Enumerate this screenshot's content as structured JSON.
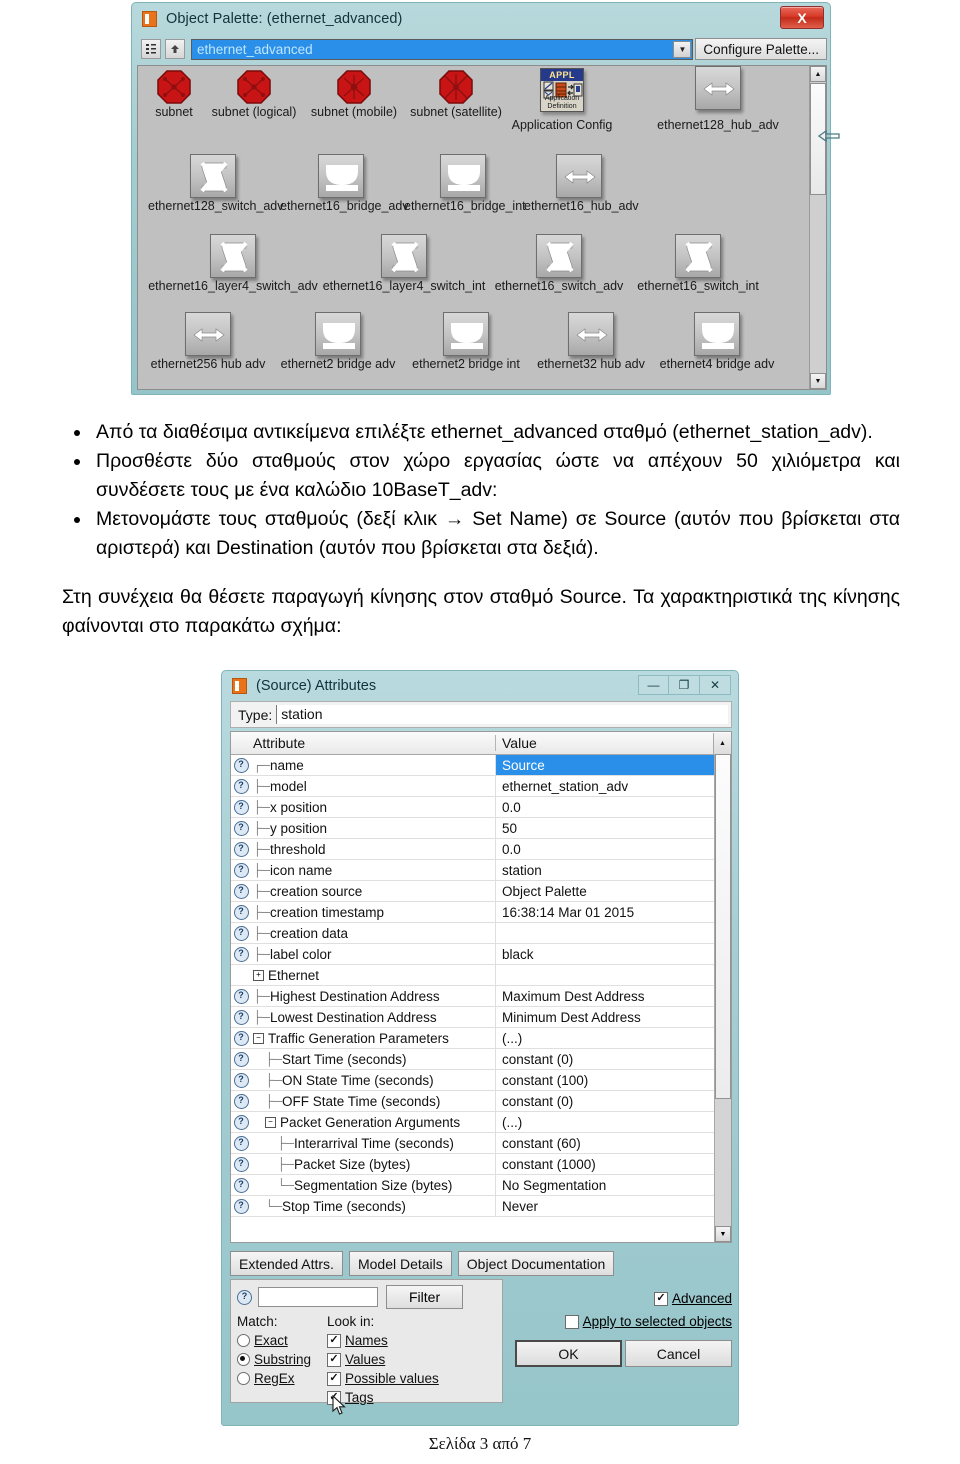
{
  "palette_window": {
    "title": "Object Palette: (ethernet_advanced)",
    "close_label": "X",
    "toolbar": {
      "tree_button_icon": "tree-view-icon",
      "up_button_icon": "up-level-icon",
      "combo_value": "ethernet_advanced",
      "combo_arrow": "▼",
      "configure_button": "Configure Palette..."
    },
    "scrollbar": {
      "up": "▲",
      "down": "▼"
    },
    "rows": [
      {
        "items": [
          {
            "label": "subnet",
            "icon": "subnet-octagon-icon"
          },
          {
            "label": "subnet (logical)",
            "icon": "subnet-logical-octagon-icon"
          },
          {
            "label": "subnet (mobile)",
            "icon": "subnet-mobile-octagon-icon"
          },
          {
            "label": "subnet (satellite)",
            "icon": "subnet-satellite-octagon-icon"
          },
          {
            "label": "Application Config",
            "icon": "application-definition-icon",
            "badge": "APPL",
            "caption": "Application\nDefinition"
          },
          {
            "label": "ethernet128_hub_adv",
            "icon": "hub-device-icon"
          }
        ]
      },
      {
        "items": [
          {
            "label": "ethernet128_switch_adv",
            "icon": "switch-device-icon"
          },
          {
            "label": "ethernet16_bridge_adv",
            "icon": "bridge-device-icon"
          },
          {
            "label": "ethernet16_bridge_int",
            "icon": "bridge-device-icon"
          },
          {
            "label": "ethernet16_hub_adv",
            "icon": "hub-device-icon"
          }
        ]
      },
      {
        "items": [
          {
            "label": "ethernet16_layer4_switch_adv",
            "icon": "switch-device-icon"
          },
          {
            "label": "ethernet16_layer4_switch_int",
            "icon": "switch-device-icon"
          },
          {
            "label": "ethernet16_switch_adv",
            "icon": "switch-device-icon"
          },
          {
            "label": "ethernet16_switch_int",
            "icon": "switch-device-icon"
          }
        ]
      },
      {
        "items": [
          {
            "label": "ethernet256 hub adv",
            "icon": "hub-device-icon"
          },
          {
            "label": "ethernet2 bridge adv",
            "icon": "bridge-device-icon"
          },
          {
            "label": "ethernet2 bridge int",
            "icon": "bridge-device-icon"
          },
          {
            "label": "ethernet32 hub adv",
            "icon": "hub-device-icon"
          },
          {
            "label": "ethernet4 bridge adv",
            "icon": "bridge-device-icon"
          }
        ]
      }
    ]
  },
  "document": {
    "bullets": [
      "Από τα διαθέσιμα αντικείμενα επιλέξτε ethernet_advanced σταθμό (ethernet_station_adv).",
      "Προσθέστε δύο σταθμούς στον χώρο εργασίας ώστε να απέχουν 50 χιλιόμετρα και συνδέσετε τους με ένα καλώδιο 10BaseT_adv:",
      "Μετονομάστε τους σταθμούς (δεξί κλικ → Set Name) σε Source (αυτόν που βρίσκεται στα αριστερά) και Destination (αυτόν που βρίσκεται στα δεξιά)."
    ],
    "paragraph": "Στη συνέχεια θα θέσετε παραγωγή κίνησης στον σταθμό Source. Τα χαρακτηριστικά της κίνησης φαίνονται στο παρακάτω σχήμα:",
    "footer": "Σελίδα 3 από 7"
  },
  "attributes_dialog": {
    "title": "(Source) Attributes",
    "window_buttons": {
      "minimize": "—",
      "maximize": "❐",
      "close": "✕"
    },
    "type_label": "Type:",
    "type_value": "station",
    "columns": {
      "attribute": "Attribute",
      "value": "Value"
    },
    "scroll": {
      "up": "▲",
      "down": "▼"
    },
    "rows": [
      {
        "name": "name",
        "value": "Source",
        "indent": 1,
        "lead": "┌─",
        "selected": true
      },
      {
        "name": "model",
        "value": "ethernet_station_adv",
        "indent": 1,
        "lead": "├─"
      },
      {
        "name": "x position",
        "value": "0.0",
        "indent": 1,
        "lead": "├─"
      },
      {
        "name": "y position",
        "value": "50",
        "indent": 1,
        "lead": "├─"
      },
      {
        "name": "threshold",
        "value": "0.0",
        "indent": 1,
        "lead": "├─"
      },
      {
        "name": "icon name",
        "value": "station",
        "indent": 1,
        "lead": "├─"
      },
      {
        "name": "creation source",
        "value": "Object Palette",
        "indent": 1,
        "lead": "├─"
      },
      {
        "name": "creation timestamp",
        "value": "16:38:14 Mar 01 2015",
        "indent": 1,
        "lead": "├─"
      },
      {
        "name": "creation data",
        "value": "",
        "indent": 1,
        "lead": "├─"
      },
      {
        "name": "label color",
        "value": "black",
        "indent": 1,
        "lead": "├─"
      },
      {
        "name": "Ethernet",
        "value": "",
        "indent": 1,
        "lead": "",
        "expander": "+",
        "no_help": true
      },
      {
        "name": "Highest Destination Address",
        "value": "Maximum Dest Address",
        "indent": 1,
        "lead": "├─"
      },
      {
        "name": "Lowest Destination Address",
        "value": "Minimum Dest Address",
        "indent": 1,
        "lead": "├─"
      },
      {
        "name": "Traffic Generation Parameters",
        "value": "(...)",
        "indent": 1,
        "lead": "",
        "expander": "−"
      },
      {
        "name": "Start Time (seconds)",
        "value": "constant (0)",
        "indent": 2,
        "lead": "├─"
      },
      {
        "name": "ON State Time (seconds)",
        "value": "constant (100)",
        "indent": 2,
        "lead": "├─"
      },
      {
        "name": "OFF State Time (seconds)",
        "value": "constant (0)",
        "indent": 2,
        "lead": "├─"
      },
      {
        "name": "Packet Generation Arguments",
        "value": "(...)",
        "indent": 2,
        "lead": "",
        "expander": "−"
      },
      {
        "name": "Interarrival Time (seconds)",
        "value": "constant (60)",
        "indent": 3,
        "lead": "├─"
      },
      {
        "name": "Packet Size (bytes)",
        "value": "constant (1000)",
        "indent": 3,
        "lead": "├─"
      },
      {
        "name": "Segmentation Size (bytes)",
        "value": "No Segmentation",
        "indent": 3,
        "lead": "└─"
      },
      {
        "name": "Stop Time (seconds)",
        "value": "Never",
        "indent": 2,
        "lead": "└─"
      }
    ],
    "buttons": {
      "extended_attrs": "Extended Attrs.",
      "model_details": "Model Details",
      "object_documentation": "Object Documentation",
      "filter": "Filter",
      "ok": "OK",
      "cancel": "Cancel"
    },
    "filter": {
      "input_value": "",
      "match_label": "Match:",
      "lookin_label": "Look in:",
      "match_options": [
        {
          "label": "Exact",
          "selected": false
        },
        {
          "label": "Substring",
          "selected": true
        },
        {
          "label": "RegEx",
          "selected": false
        }
      ],
      "lookin_options": [
        {
          "label": "Names",
          "checked": true
        },
        {
          "label": "Values",
          "checked": true
        },
        {
          "label": "Possible values",
          "checked": true
        },
        {
          "label": "Tags",
          "checked": true
        }
      ]
    },
    "right_options": [
      {
        "label": "Advanced",
        "checked": true
      },
      {
        "label": "Apply to selected objects",
        "checked": false
      }
    ]
  },
  "colors": {
    "window_chrome": "#a6cfd4",
    "selection_blue": "#2a8fe8",
    "close_red": "#d83a28",
    "device_grey": "#c4c4c4",
    "subnet_red": "#cc1111"
  }
}
